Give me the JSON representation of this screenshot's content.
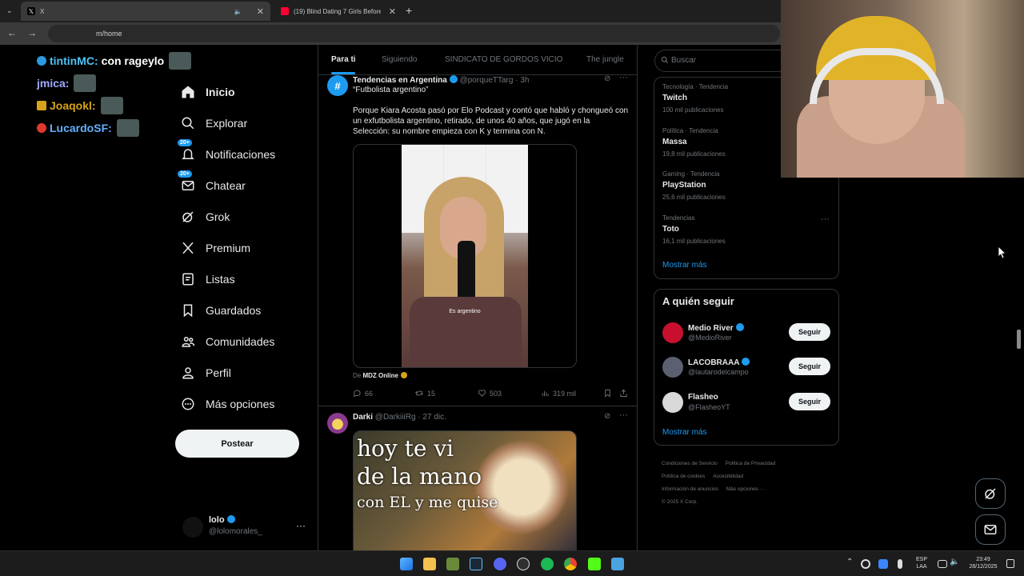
{
  "browser": {
    "tabs": [
      {
        "label": "X"
      },
      {
        "label": "(19) Blind Dating 7 Girls Before"
      }
    ],
    "new_tab": "+",
    "address": "m/home"
  },
  "chat": [
    {
      "user": "tintinMC:",
      "message": "con rageylo",
      "color": "#4fc3f7"
    },
    {
      "user": "jmica:",
      "message": "",
      "color": "#9fa8ff"
    },
    {
      "user": "Joaqokl:",
      "message": "",
      "color": "#d8a31a"
    },
    {
      "user": "LucardoSF:",
      "message": "",
      "color": "#62b0ff"
    }
  ],
  "nav": {
    "items": [
      {
        "label": "Inicio",
        "icon": "home-icon"
      },
      {
        "label": "Explorar",
        "icon": "search-icon"
      },
      {
        "label": "Notificaciones",
        "icon": "bell-icon",
        "badge": "20+"
      },
      {
        "label": "Chatear",
        "icon": "mail-icon",
        "badge": "20+"
      },
      {
        "label": "Grok",
        "icon": "grok-icon"
      },
      {
        "label": "Premium",
        "icon": "x-logo-icon"
      },
      {
        "label": "Listas",
        "icon": "list-icon"
      },
      {
        "label": "Guardados",
        "icon": "bookmark-icon"
      },
      {
        "label": "Comunidades",
        "icon": "people-icon"
      },
      {
        "label": "Perfil",
        "icon": "person-icon"
      },
      {
        "label": "Más opciones",
        "icon": "more-circle-icon"
      }
    ],
    "post_button": "Postear"
  },
  "profile": {
    "name": "lolo",
    "handle": "@lolomorales_",
    "more": "···"
  },
  "feed": {
    "tabs": [
      "Para ti",
      "Siguiendo",
      "SINDICATO DE GORDOS VICIO",
      "The jungle"
    ],
    "posts": [
      {
        "author": "Tendencias en Argentina",
        "handle": "@porqueTTarg · 3h",
        "text1": "“Futbolista argentino”",
        "text2": "Porque Kiara Acosta pasó por Elo Podcast y contó que habló y chongueó con un exfutbolista argentino, retirado, de unos 40 años, que jugó en la Selección: su nombre empieza con K y termina con N.",
        "media_caption": "Es argentino",
        "source_prefix": "De",
        "source": "MDZ Online",
        "replies": "66",
        "reposts": "15",
        "likes": "503",
        "views": "319 mil"
      },
      {
        "author": "Darki",
        "handle": "@DarkiiiRg · 27 dic.",
        "meme_line1": "hoy te vi",
        "meme_line2": "de la mano",
        "meme_line3": "con EL y me quise"
      }
    ]
  },
  "right": {
    "search_placeholder": "Buscar",
    "trends": [
      {
        "category": "Tecnología · Tendencia",
        "name": "Twitch",
        "count": "100 mil publicaciones"
      },
      {
        "category": "Política · Tendencia",
        "name": "Massa",
        "count": "19,8 mil publicaciones"
      },
      {
        "category": "Gaming · Tendencia",
        "name": "PlayStation",
        "count": "25,6 mil publicaciones"
      },
      {
        "category": "Tendencias",
        "name": "Toto",
        "count": "16,1 mil publicaciones"
      }
    ],
    "show_more": "Mostrar más",
    "who_to_follow_title": "A quién seguir",
    "who_to_follow": [
      {
        "name": "Medio River",
        "handle": "@MedioRiver",
        "button": "Seguir",
        "avatar_color": "#c8102e"
      },
      {
        "name": "LACOBRAAA",
        "handle": "@lautarodelcampo",
        "button": "Seguir",
        "avatar_color": "#5a6070"
      },
      {
        "name": "Flasheo",
        "handle": "@FlasheoYT",
        "button": "Seguir",
        "avatar_color": "#d9d9d9"
      }
    ],
    "show_more_2": "Mostrar más",
    "footer": [
      "Condiciones de Servicio",
      "Política de Privacidad",
      "Política de cookies",
      "Accesibilidad",
      "Información de anuncios",
      "Más opciones ···",
      "© 2025 X Corp."
    ]
  },
  "taskbar": {
    "lang1": "ESP",
    "lang2": "LAA",
    "time": "23:49",
    "date": "28/12/2025"
  },
  "colors": {
    "accent": "#1d9bf0",
    "background": "#000000",
    "border": "#2f3336",
    "muted": "#71767b"
  }
}
